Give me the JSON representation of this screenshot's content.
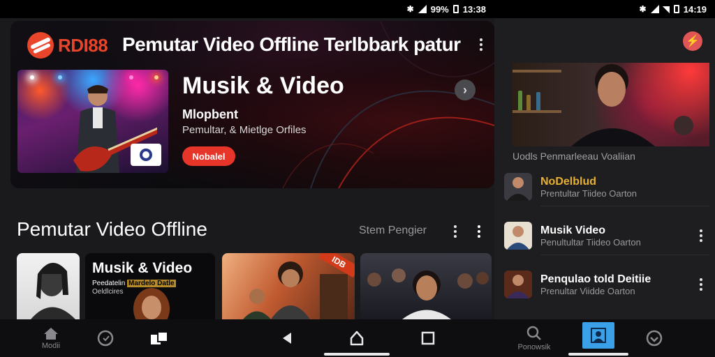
{
  "status_left": {
    "battery": "99%",
    "time": "13:38"
  },
  "status_right": {
    "time": "14:19"
  },
  "header": {
    "brand_name": "RDI88",
    "title": "Pemutar Video Offline Terlbbark patur"
  },
  "hero": {
    "title": "Musik & Video",
    "subtitle": "Mlopbent",
    "description": "Pemultar, & Mietlge Orfiles",
    "button_label": "Nobalel",
    "next_icon": "chevron-right-icon"
  },
  "section": {
    "title": "Pemutar Video Offline",
    "action_label": "Stem Pengier"
  },
  "cards": {
    "c2_title": "Musik & Video",
    "c2_tag1": "Peedatelin",
    "c2_tag1_highlight": "Mardelo Datle",
    "c2_tag2": "Oeldlcires",
    "c3_ribbon": "IDB"
  },
  "right_panel": {
    "caption": "Uodls Penmarleeau Voaliian",
    "items": [
      {
        "title": "NoDelblud",
        "subtitle": "Prentultar Tiideo Oarton",
        "accent": true
      },
      {
        "title": "Musik Video",
        "subtitle": "Penultultar Tiideo Oarton",
        "accent": false
      },
      {
        "title": "Penqulao told Deitiie",
        "subtitle": "Prenultar Viidde Oarton",
        "accent": false
      }
    ]
  },
  "bottom_nav": {
    "left_tab1_label": "Modii",
    "right_tab1_label": "Ponowsik"
  },
  "colors": {
    "accent": "#e8452b",
    "button": "#e8352a",
    "active_tab": "#3aa0e8",
    "highlight_text": "#e8b030"
  }
}
